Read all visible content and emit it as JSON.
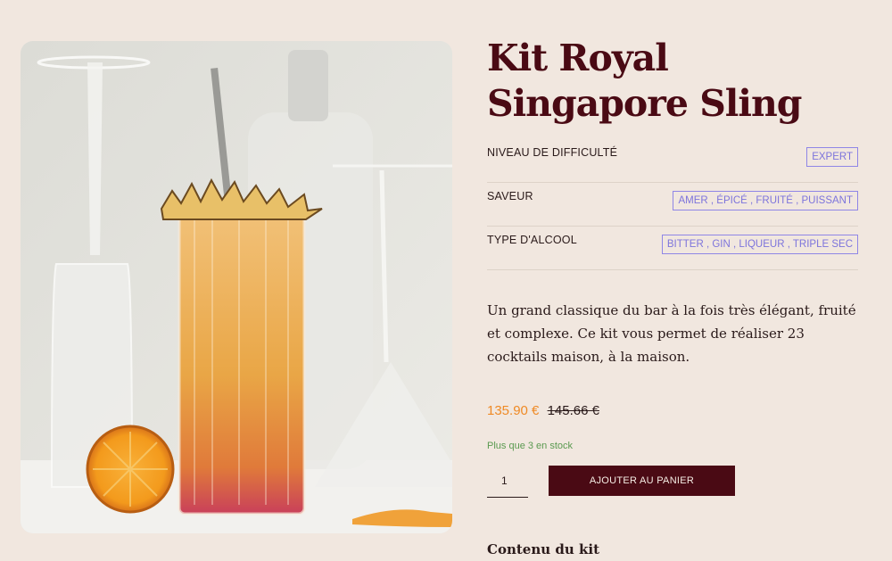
{
  "product": {
    "title_line1": "Kit Royal",
    "title_line2": "Singapore Sling",
    "image_subject": "cocktail-photo"
  },
  "attributes": [
    {
      "label": "NIVEAU DE DIFFICULTÉ",
      "value": "EXPERT"
    },
    {
      "label": "SAVEUR",
      "value": "AMER , ÉPICÉ , FRUITÉ , PUISSANT"
    },
    {
      "label": "TYPE D'ALCOOL",
      "value": "BITTER , GIN , LIQUEUR , TRIPLE SEC"
    }
  ],
  "description": "Un grand classique du bar à la fois très élégant, fruité et complexe. Ce kit vous permet de réaliser 23 cocktails maison, à la maison.",
  "pricing": {
    "price": "135.90 €",
    "old_price": "145.66 €"
  },
  "stock_text": "Plus que 3 en stock",
  "cart": {
    "quantity": "1",
    "add_label": "AJOUTER AU PANIER"
  },
  "section_title": "Contenu du kit",
  "colors": {
    "background": "#f1e7df",
    "brand": "#4a0a14",
    "price": "#ef8a25",
    "tag": "#7d74dc",
    "stock": "#5a9a50"
  }
}
